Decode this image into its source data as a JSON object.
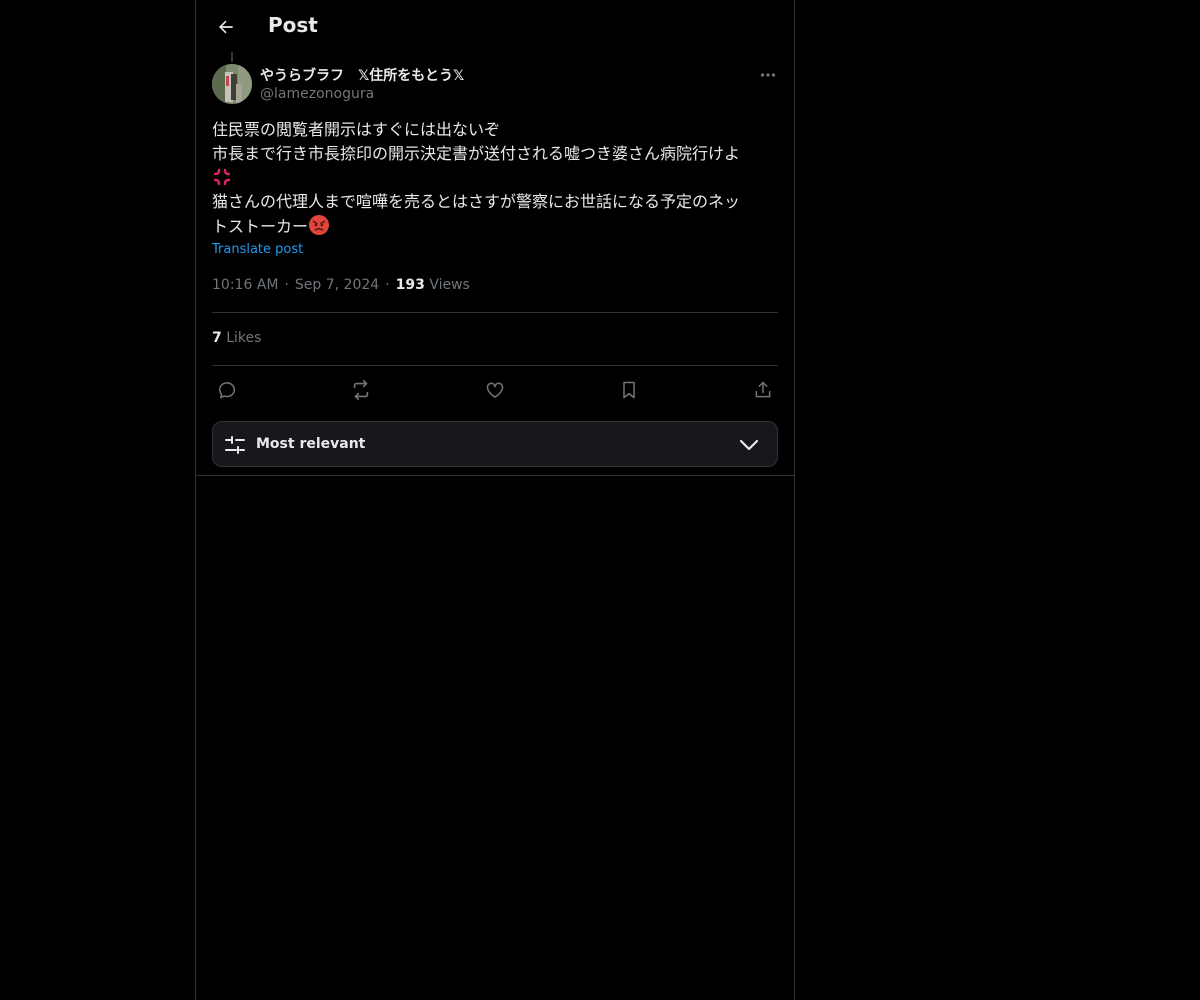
{
  "header": {
    "title": "Post"
  },
  "author": {
    "display_name": "やうらブラフ　𝕏住所をもとう𝕏",
    "handle": "@lamezonogura"
  },
  "post": {
    "lines": [
      "住民票の閲覧者開示はすぐには出ないぞ",
      "市長まで行き市長捺印の開示決定書が送付される嘘つき婆さん病院行けよ",
      "猫さんの代理人まで喧嘩を売るとはさすが警察にお世話になる予定のネッ",
      "トストーカー"
    ],
    "emojis": [
      "anger-symbol",
      "angry-face"
    ],
    "translate_label": "Translate post"
  },
  "meta": {
    "time": "10:16 AM",
    "date": "Sep 7, 2024",
    "views_count": "193",
    "views_label": "Views",
    "separator": "·"
  },
  "stats": {
    "likes_count": "7",
    "likes_label": "Likes"
  },
  "actions": [
    "reply",
    "repost",
    "like",
    "bookmark",
    "share"
  ],
  "sort": {
    "label": "Most relevant"
  },
  "colors": {
    "background": "#000000",
    "text": "#e7e9ea",
    "muted": "#71767b",
    "link": "#1d9bf0",
    "border": "#2f3336"
  }
}
